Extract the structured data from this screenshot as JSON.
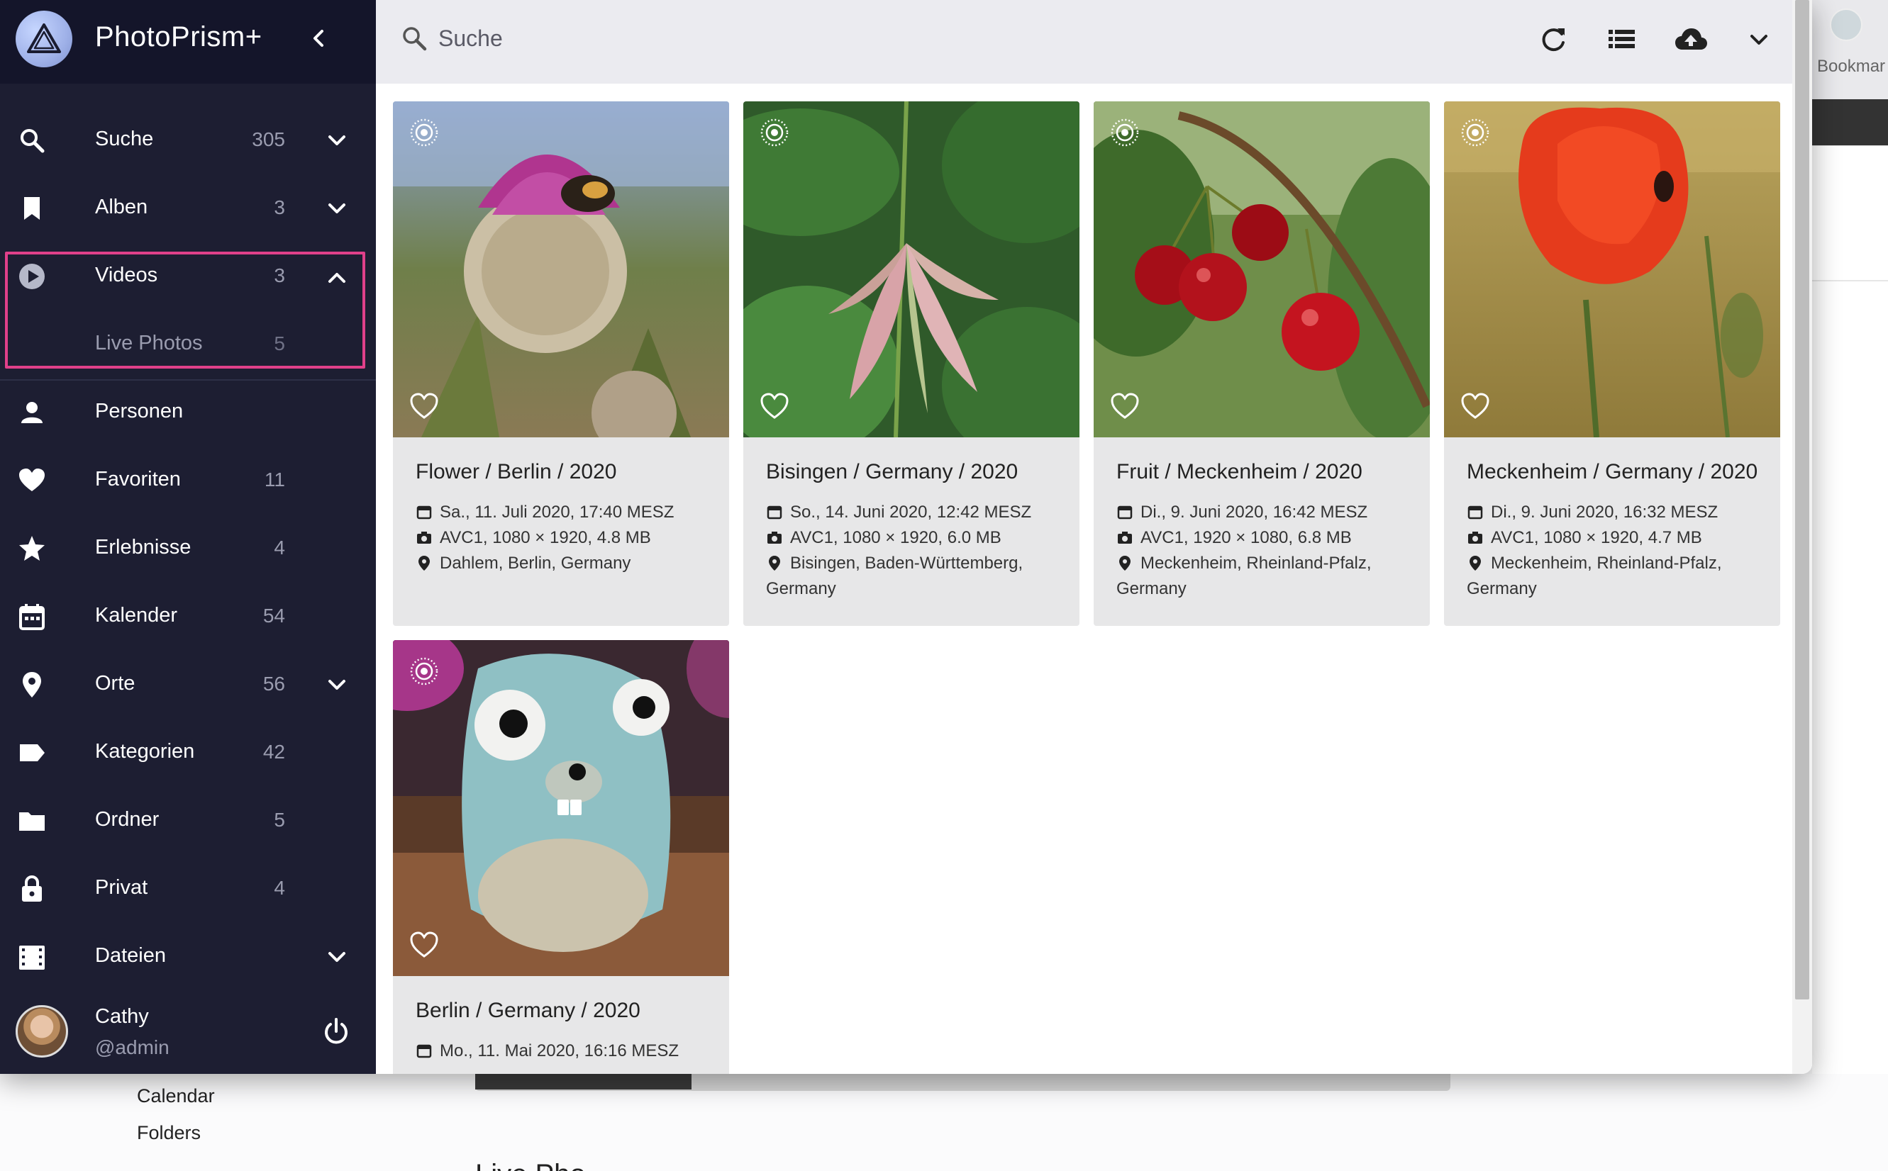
{
  "app": {
    "title": "PhotoPrism+"
  },
  "sidebar": {
    "items": [
      {
        "label": "Suche",
        "count": "305"
      },
      {
        "label": "Alben",
        "count": "3"
      },
      {
        "label": "Videos",
        "count": "3"
      },
      {
        "label": "Live Photos",
        "count": "5"
      },
      {
        "label": "Personen",
        "count": ""
      },
      {
        "label": "Favoriten",
        "count": "11"
      },
      {
        "label": "Erlebnisse",
        "count": "4"
      },
      {
        "label": "Kalender",
        "count": "54"
      },
      {
        "label": "Orte",
        "count": "56"
      },
      {
        "label": "Kategorien",
        "count": "42"
      },
      {
        "label": "Ordner",
        "count": "5"
      },
      {
        "label": "Privat",
        "count": "4"
      },
      {
        "label": "Dateien",
        "count": ""
      }
    ],
    "user": {
      "name": "Cathy",
      "handle": "@admin"
    }
  },
  "toolbar": {
    "search_placeholder": "Suche"
  },
  "cards": [
    {
      "title": "Flower / Berlin / 2020",
      "date": "Sa., 11. Juli 2020, 17:40 MESZ",
      "camera": "AVC1, 1080 × 1920, 4.8 MB",
      "location": "Dahlem, Berlin, Germany",
      "location2": ""
    },
    {
      "title": "Bisingen / Germany / 2020",
      "date": "So., 14. Juni 2020, 12:42 MESZ",
      "camera": "AVC1, 1080 × 1920, 6.0 MB",
      "location": "Bisingen, Baden-Württemberg,",
      "location2": "Germany"
    },
    {
      "title": "Fruit / Meckenheim / 2020",
      "date": "Di., 9. Juni 2020, 16:42 MESZ",
      "camera": "AVC1, 1920 × 1080, 6.8 MB",
      "location": "Meckenheim, Rheinland-Pfalz,",
      "location2": "Germany"
    },
    {
      "title": "Meckenheim / Germany / 2020",
      "date": "Di., 9. Juni 2020, 16:32 MESZ",
      "camera": "AVC1, 1080 × 1920, 4.7 MB",
      "location": "Meckenheim, Rheinland-Pfalz,",
      "location2": "Germany"
    },
    {
      "title": "Berlin / Germany / 2020",
      "date": "Mo., 11. Mai 2020, 16:16 MESZ",
      "camera": "",
      "location": "",
      "location2": ""
    }
  ],
  "background": {
    "bookmark_text": "Bookmar",
    "nav_items": [
      "Calendar",
      "Folders"
    ],
    "cutoff_text": "Live Pho"
  },
  "colors": {
    "sidebar_bg": "#1d1e32",
    "highlight": "#e0408a",
    "toolbar_bg": "#ebebf0",
    "card_bg": "#e7e7e8"
  }
}
